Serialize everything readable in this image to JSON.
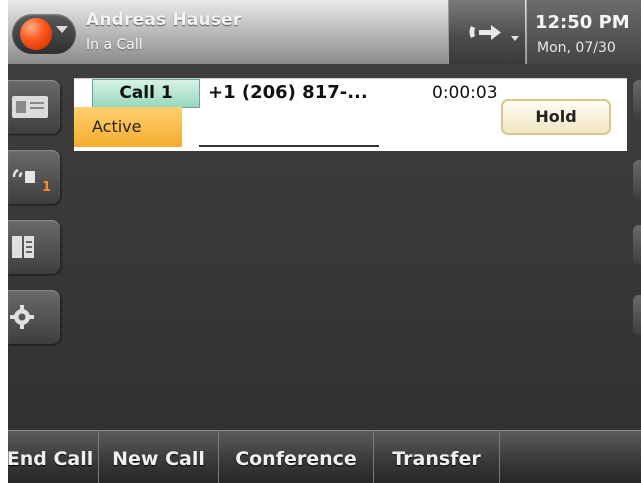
{
  "status_bar": {
    "user_name": "Andreas Hauser",
    "user_status": "In a Call",
    "time": "12:50 PM",
    "date": "Mon, 07/30",
    "presence_color": "#ff5a1f"
  },
  "side_buttons": [
    {
      "icon": "contact-card-icon"
    },
    {
      "icon": "voicemail-icon",
      "badge": "1"
    },
    {
      "icon": "directory-icon"
    },
    {
      "icon": "settings-gear-icon"
    }
  ],
  "call": {
    "tab_label": "Call 1",
    "number": "+1 (206) 817-...",
    "duration": "0:00:03",
    "state": "Active",
    "hold_label": "Hold"
  },
  "softkeys": [
    "End Call",
    "New Call",
    "Conference",
    "Transfer"
  ],
  "colors": {
    "active_badge": "#f4ad2e",
    "call_tab": "#98d8bd",
    "voicemail_badge": "#ff8a1f"
  }
}
